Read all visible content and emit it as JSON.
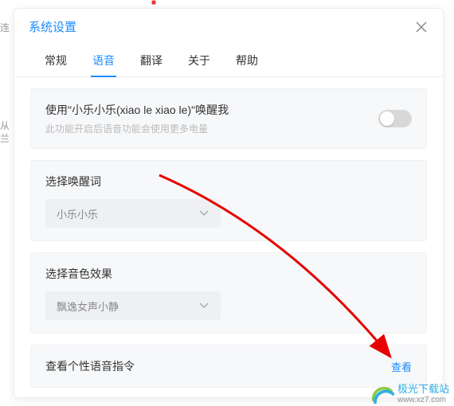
{
  "cropped_text": {
    "line1": "从",
    "line2": "兰",
    "line3": "连",
    "top_red": "■"
  },
  "modal": {
    "title": "系统设置",
    "tabs": [
      "常规",
      "语音",
      "翻译",
      "关于",
      "帮助"
    ],
    "active_tab_index": 1,
    "wake_section": {
      "title": "使用\"小乐小乐(xiao le xiao le)\"唤醒我",
      "subtitle": "此功能开启后语音功能会使用更多电量",
      "toggle_on": false
    },
    "wake_word_section": {
      "label": "选择唤醒词",
      "selected": "小乐小乐"
    },
    "voice_effect_section": {
      "label": "选择音色效果",
      "selected": "飘逸女声小静"
    },
    "custom_cmd_section": {
      "label": "查看个性语音指令",
      "link": "查看"
    }
  },
  "watermark": {
    "site_name": "极光下载站",
    "site_url": "www.xz7.com"
  }
}
